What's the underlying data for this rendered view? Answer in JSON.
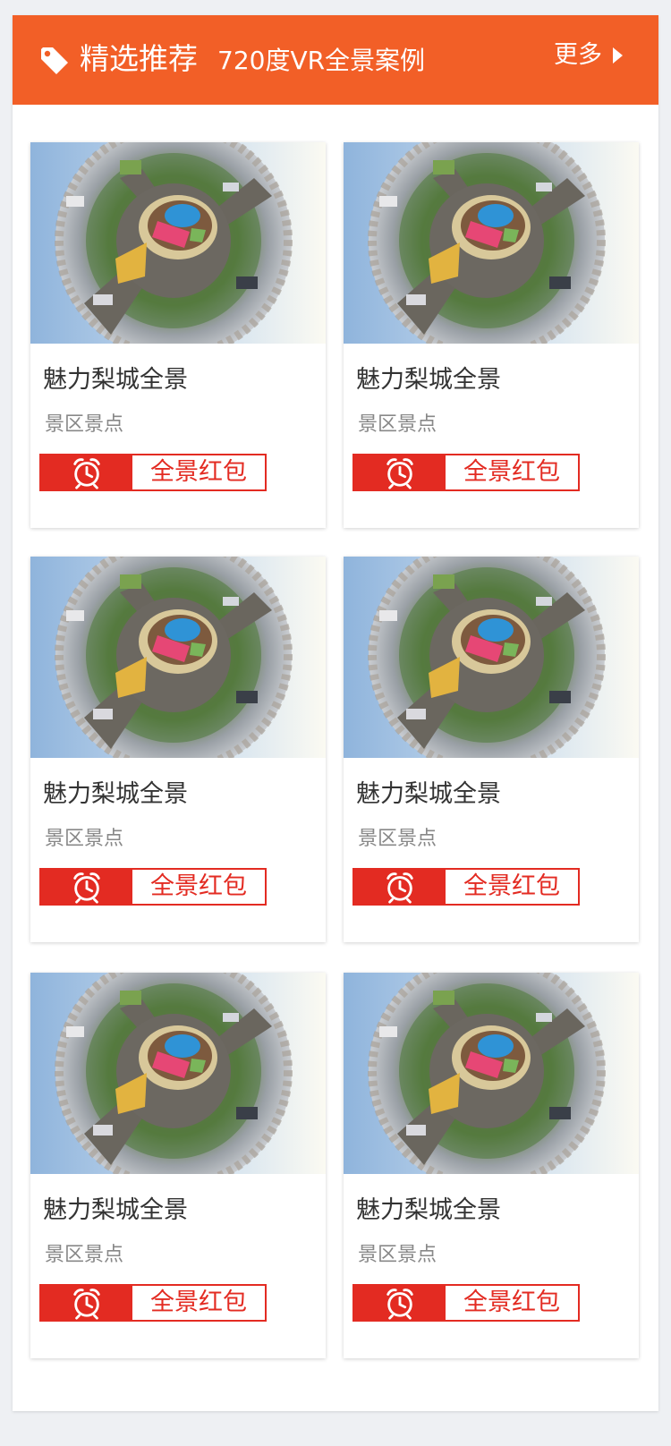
{
  "header": {
    "title": "精选推荐",
    "subtitle": "720度VR全景案例",
    "more_label": "更多",
    "background_color": "#f25f27",
    "icon": "tag-icon"
  },
  "cards": [
    {
      "title": "魅力梨城全景",
      "category": "景区景点",
      "badge_label": "全景红包",
      "badge_icon": "alarm-clock-icon"
    },
    {
      "title": "魅力梨城全景",
      "category": "景区景点",
      "badge_label": "全景红包",
      "badge_icon": "alarm-clock-icon"
    },
    {
      "title": "魅力梨城全景",
      "category": "景区景点",
      "badge_label": "全景红包",
      "badge_icon": "alarm-clock-icon"
    },
    {
      "title": "魅力梨城全景",
      "category": "景区景点",
      "badge_label": "全景红包",
      "badge_icon": "alarm-clock-icon"
    },
    {
      "title": "魅力梨城全景",
      "category": "景区景点",
      "badge_label": "全景红包",
      "badge_icon": "alarm-clock-icon"
    },
    {
      "title": "魅力梨城全景",
      "category": "景区景点",
      "badge_label": "全景红包",
      "badge_icon": "alarm-clock-icon"
    }
  ],
  "colors": {
    "accent_red": "#e32b22",
    "page_bg": "#eef0f3"
  }
}
